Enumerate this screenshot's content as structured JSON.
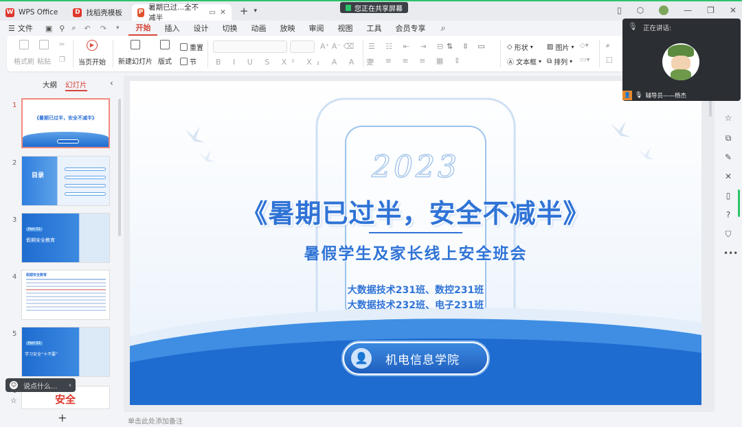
{
  "app": {
    "tabs": [
      {
        "label": "WPS Office"
      },
      {
        "label": "找稻壳模板"
      },
      {
        "label": "暑期已过...全不减半"
      }
    ],
    "share_status": "您正在共享屏幕"
  },
  "menu": {
    "file": "文件",
    "items": [
      "开始",
      "插入",
      "设计",
      "切换",
      "动画",
      "放映",
      "审阅",
      "视图",
      "工具",
      "会员专享"
    ],
    "active": "开始"
  },
  "ribbon": {
    "format_painter": "格式刷",
    "paste": "粘贴",
    "play_from_current": "当页开始",
    "new_slide": "新建幻灯片",
    "layout": "版式",
    "reset": "重置",
    "section": "节",
    "shape": "形状",
    "image": "图片",
    "textbox": "文本框",
    "arrange": "排列"
  },
  "left_panel": {
    "outline_tab": "大纲",
    "slides_tab": "幻灯片",
    "thumbnails": [
      {
        "num": "1",
        "title": "《暑期已过半，安全不减半》"
      },
      {
        "num": "2",
        "title": "目录"
      },
      {
        "num": "3",
        "title": "假期安全教育",
        "badge": "Part 01"
      },
      {
        "num": "4",
        "title": "假期安全教育"
      },
      {
        "num": "5",
        "title": "学习安全“十不要”",
        "badge": "Part 02"
      },
      {
        "num": "6",
        "title": "安全"
      }
    ]
  },
  "slide": {
    "year": "2023",
    "title": "《暑期已过半，安全不减半》",
    "subtitle": "暑假学生及家长线上安全班会",
    "classes_line1": "大数据技术231班、数控231班",
    "classes_line2": "大数据技术232班、电子231班",
    "college": "机电信息学院"
  },
  "notes_placeholder": "单击此处添加备注",
  "meeting": {
    "speaking_label": "正在讲话:",
    "speaker": "辅导员——杨杰"
  },
  "comment_placeholder": "说点什么..."
}
